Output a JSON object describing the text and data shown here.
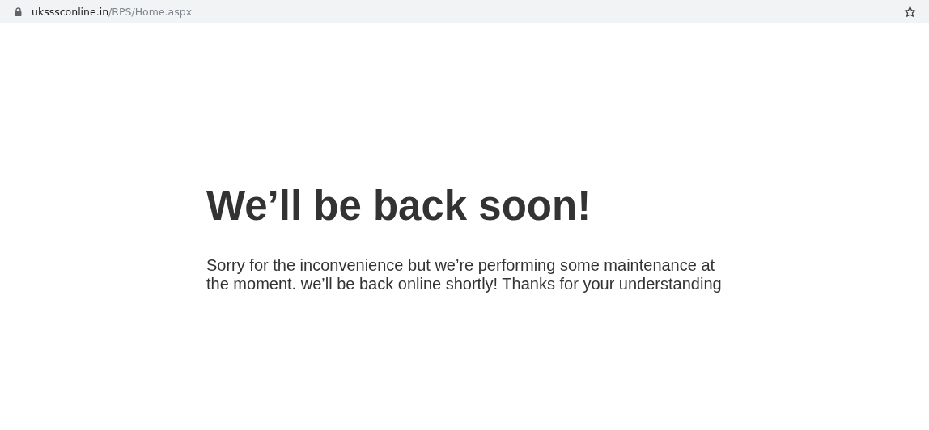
{
  "address_bar": {
    "host": "uksssconline.in",
    "path": "/RPS/Home.aspx"
  },
  "heading": "We’ll be back soon!",
  "message": "Sorry for the inconvenience but we’re performing some maintenance at the moment. we’ll be back online shortly! Thanks for your understanding"
}
